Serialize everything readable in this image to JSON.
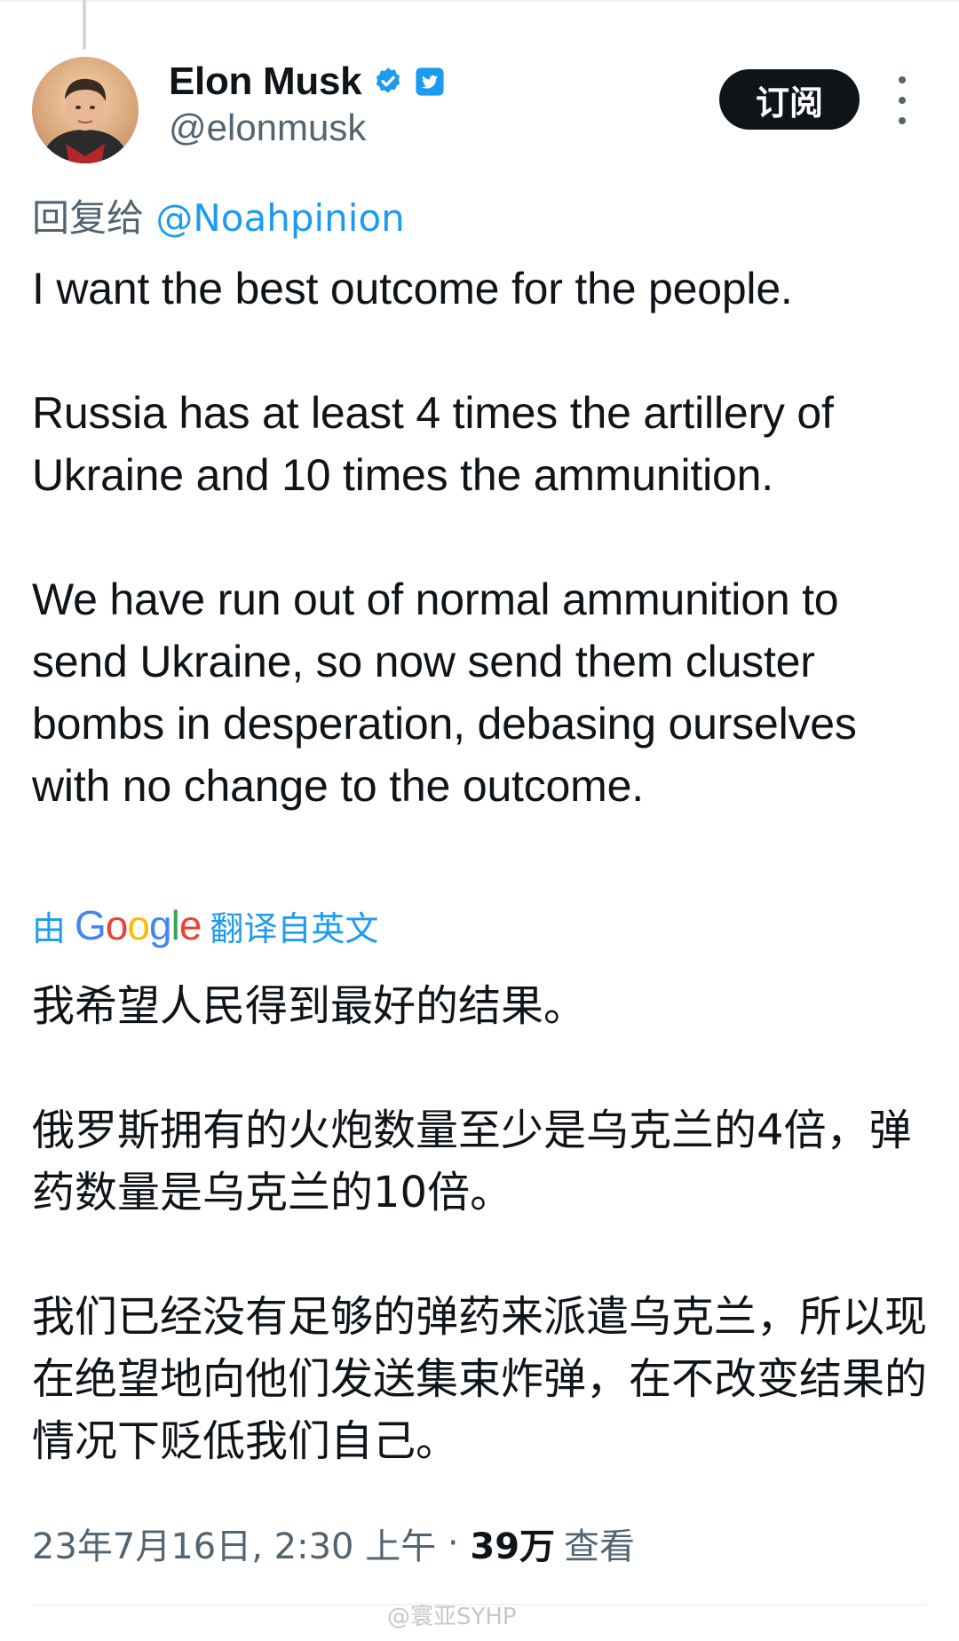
{
  "author": {
    "display_name": "Elon Musk",
    "handle": "@elonmusk",
    "avatar_icon": "profile-photo"
  },
  "header": {
    "subscribe_label": "订阅"
  },
  "reply": {
    "prefix": "回复给",
    "mention": "@Noahpinion"
  },
  "tweet": {
    "text": "I want the best outcome for the people.\n\nRussia has at least 4 times the artillery of Ukraine and 10 times the ammunition.\n\nWe have run out of normal ammunition to send Ukraine, so now send them cluster bombs in desperation, debasing ourselves with no change to the outcome."
  },
  "translation": {
    "prefix": "由",
    "provider": "Google",
    "suffix": "翻译自英文",
    "text": "我希望人民得到最好的结果。\n\n俄罗斯拥有的火炮数量至少是乌克兰的4倍，弹药数量是乌克兰的10倍。\n\n我们已经没有足够的弹药来派遣乌克兰，所以现在绝望地向他们发送集束炸弹，在不改变结果的情况下贬低我们自己。"
  },
  "meta": {
    "timestamp": "23年7月16日, 2:30 上午",
    "separator": " · ",
    "views_count": "39万",
    "views_label": "查看"
  },
  "watermark": "@寰亚SYHP",
  "colors": {
    "link_blue": "#1d9bf0",
    "secondary_text": "#536471",
    "primary_text": "#0f1419"
  }
}
